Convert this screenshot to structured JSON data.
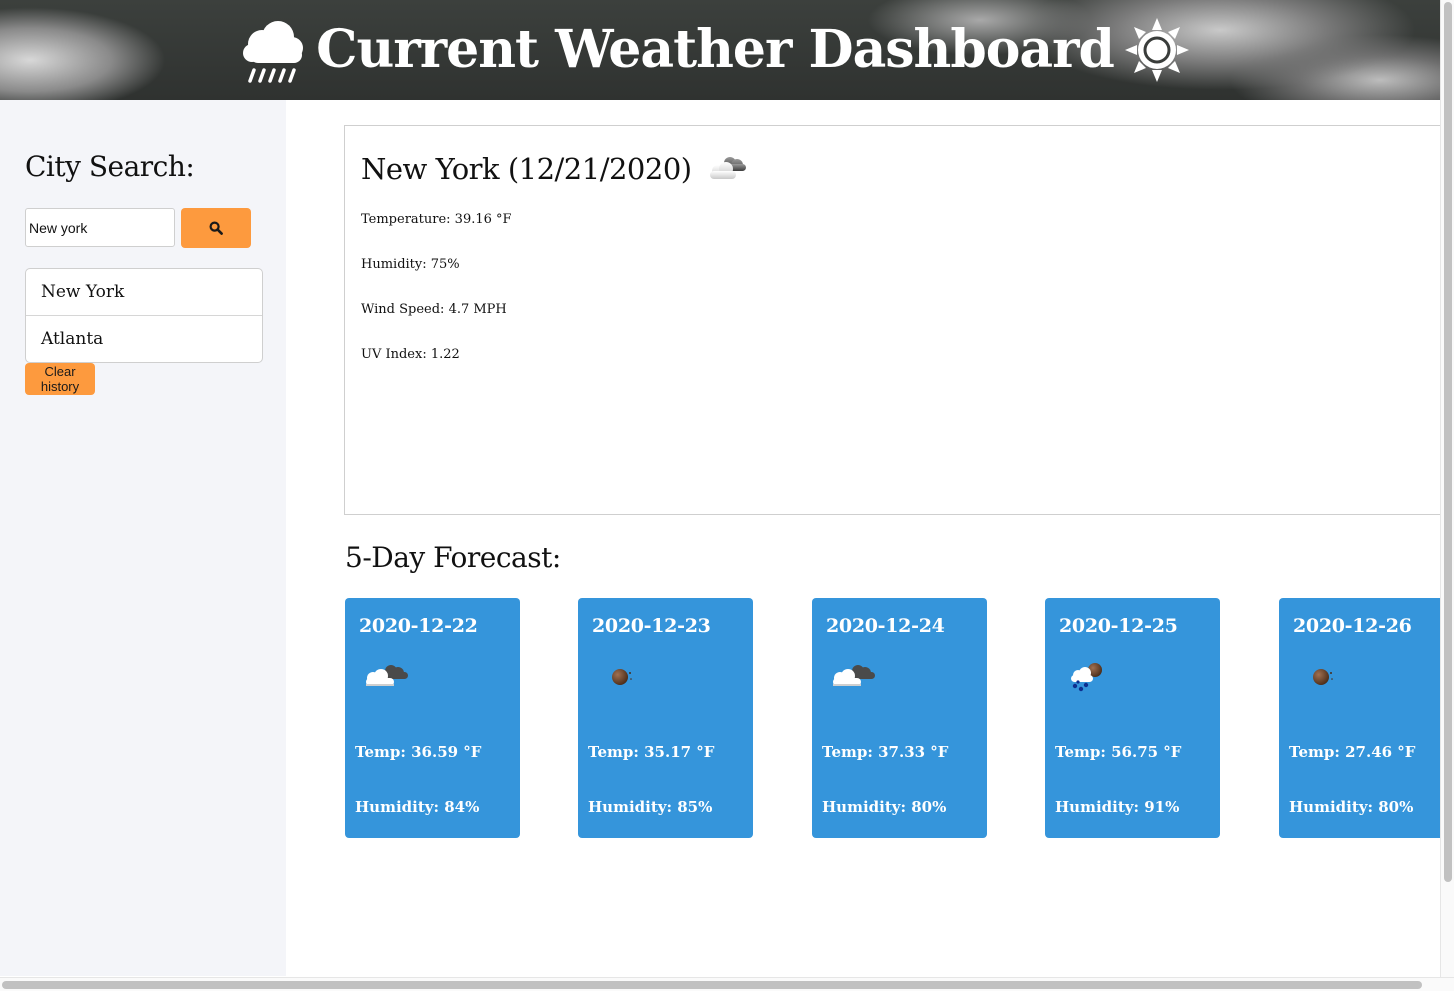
{
  "header": {
    "title": "Current Weather Dashboard",
    "left_icon": "cloud-rain-icon",
    "right_icon": "sun-icon"
  },
  "sidebar": {
    "title": "City Search:",
    "search": {
      "value": "New york",
      "button_icon": "search-icon"
    },
    "history": [
      {
        "label": "New York"
      },
      {
        "label": "Atlanta"
      }
    ],
    "clear_label": "Clear history"
  },
  "current": {
    "heading": "New York (12/21/2020)",
    "icon": "cloud-partly-icon",
    "temperature": "Temperature: 39.16 °F",
    "humidity": "Humidity: 75%",
    "wind": "Wind Speed: 4.7 MPH",
    "uv": "UV Index: 1.22"
  },
  "forecast": {
    "title": "5-Day Forecast:",
    "days": [
      {
        "date": "2020-12-22",
        "icon": "broken-clouds-icon",
        "temp": "Temp: 36.59 °F",
        "humidity": "Humidity: 84%"
      },
      {
        "date": "2020-12-23",
        "icon": "clear-night-icon",
        "temp": "Temp: 35.17 °F",
        "humidity": "Humidity: 85%"
      },
      {
        "date": "2020-12-24",
        "icon": "broken-clouds-icon",
        "temp": "Temp: 37.33 °F",
        "humidity": "Humidity: 80%"
      },
      {
        "date": "2020-12-25",
        "icon": "rain-night-icon",
        "temp": "Temp: 56.75 °F",
        "humidity": "Humidity: 91%"
      },
      {
        "date": "2020-12-26",
        "icon": "clear-night-icon",
        "temp": "Temp: 27.46 °F",
        "humidity": "Humidity: 80%"
      }
    ]
  },
  "colors": {
    "accent_orange": "#fd9a3e",
    "card_blue": "#3595db",
    "sidebar_bg": "#f4f5f9"
  }
}
